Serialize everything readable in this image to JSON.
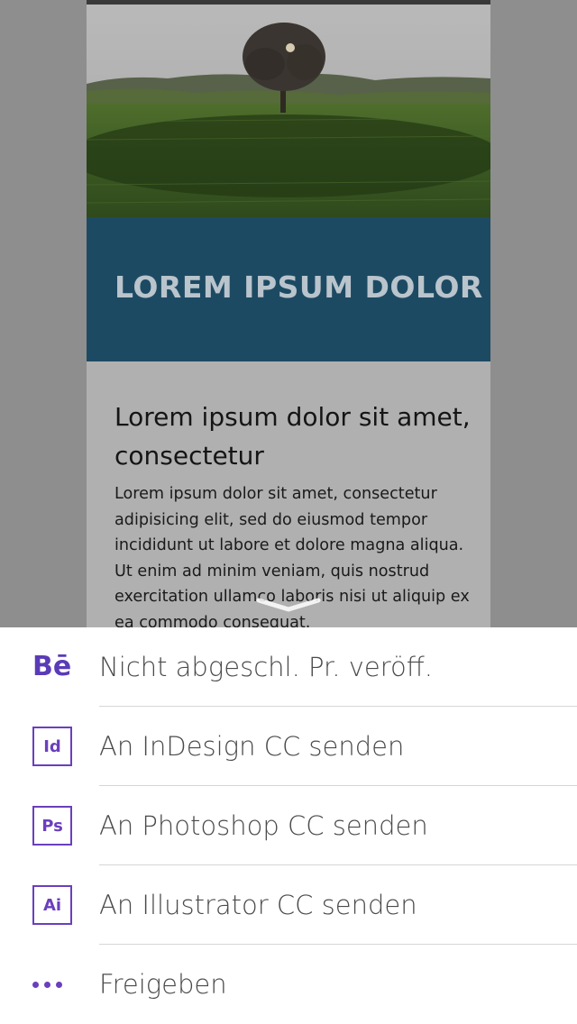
{
  "preview": {
    "banner_title": "LOREM IPSUM DOLOR",
    "heading": "Lorem ipsum dolor sit amet, consectetur",
    "body": "Lorem ipsum dolor sit amet, consectetur adipisicing elit, sed do eiusmod tempor incididunt ut labore et dolore magna aliqua. Ut enim ad minim veniam, quis nostrud exercitation ullamco laboris nisi ut aliquip ex ea commodo consequat."
  },
  "share_sheet": {
    "items": [
      {
        "icon": "behance-icon",
        "icon_text": "Bē",
        "label": "Nicht abgeschl. Pr. veröff."
      },
      {
        "icon": "indesign-icon",
        "icon_text": "Id",
        "label": "An InDesign CC senden"
      },
      {
        "icon": "photoshop-icon",
        "icon_text": "Ps",
        "label": "An Photoshop CC senden"
      },
      {
        "icon": "illustrator-icon",
        "icon_text": "Ai",
        "label": "An Illustrator CC senden"
      },
      {
        "icon": "more-dots-icon",
        "icon_text": "",
        "label": "Freigeben"
      }
    ]
  },
  "colors": {
    "accent": "#6a3fbe",
    "banner": "#1d4a63",
    "dim_overlay": "#8e8e8e"
  }
}
